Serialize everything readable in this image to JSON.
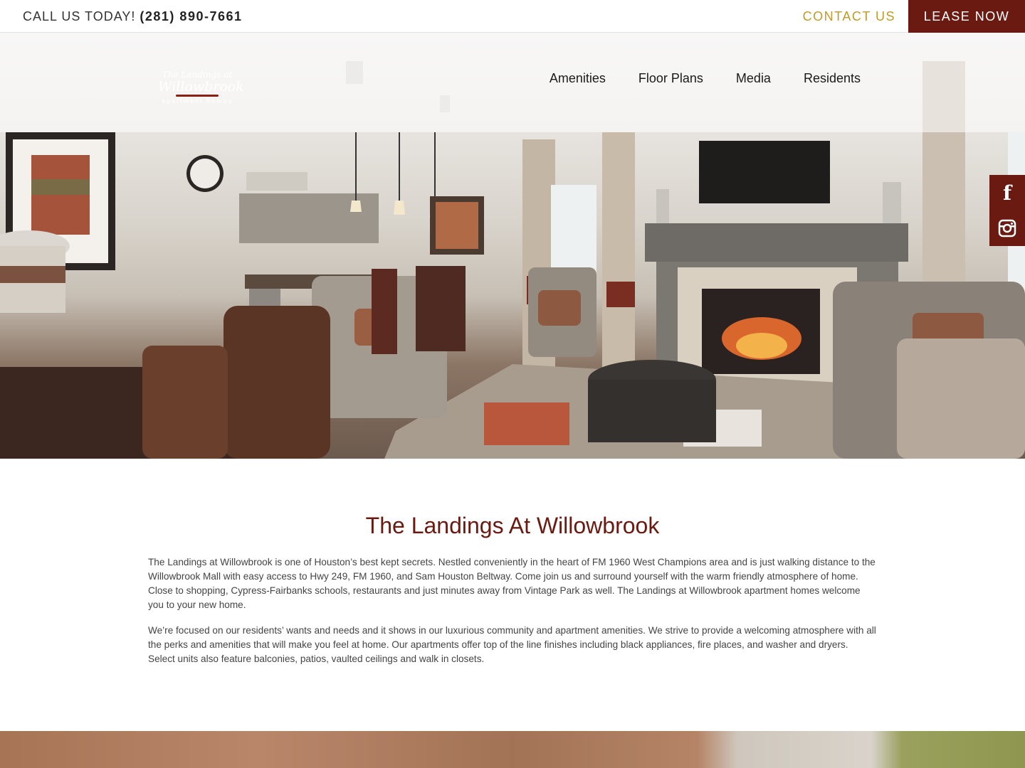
{
  "topbar": {
    "call_label": "CALL US TODAY!",
    "phone": "(281) 890-7661",
    "contact_label": "CONTACT US",
    "lease_label": "LEASE NOW"
  },
  "logo": {
    "line1": "The Landings at",
    "line2": "Willowbrook",
    "line3": "apartment homes"
  },
  "nav": {
    "items": [
      "Amenities",
      "Floor Plans",
      "Media",
      "Residents"
    ]
  },
  "social": {
    "facebook_glyph": "f",
    "instagram_icon": "instagram-icon"
  },
  "main": {
    "title": "The Landings At Willowbrook",
    "paragraph1": "The Landings at Willowbrook is one of Houston’s best kept secrets. Nestled conveniently in the heart of FM 1960 West Champions area and is just walking distance to the Willowbrook Mall with easy access to Hwy 249, FM 1960, and Sam Houston Beltway. Come join us and surround yourself with the warm friendly atmosphere of home. Close to shopping, Cypress-Fairbanks schools, restaurants and just minutes away from Vintage Park as well. The Landings at Willowbrook apartment homes welcome you to your new home.",
    "paragraph2": "We’re focused on our residents’ wants and needs and it shows in our luxurious community and apartment amenities. We strive to provide a welcoming atmosphere with all the perks and amenities that will make you feel at home. Our apartments offer top of the line finishes including black appliances, fire places, and washer and dryers. Select units also feature balconies, patios, vaulted ceilings and walk in closets."
  },
  "colors": {
    "brand": "#6b1a12",
    "accent": "#c09a2a"
  }
}
